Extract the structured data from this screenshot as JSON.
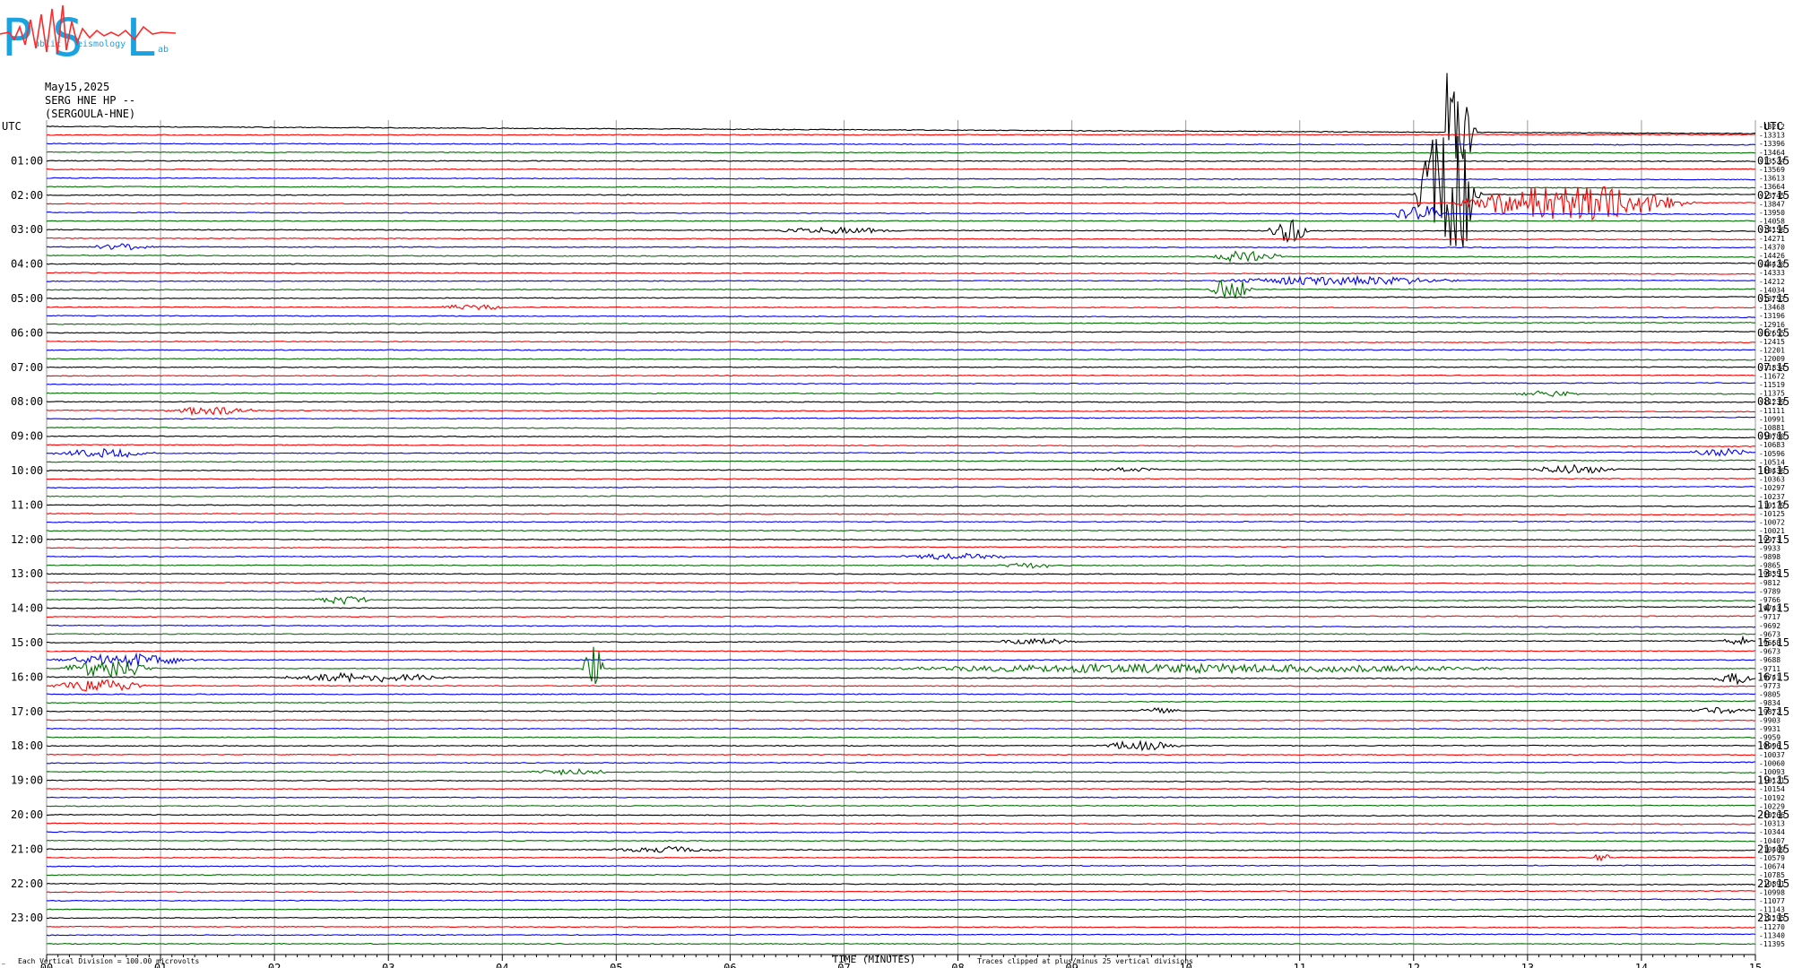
{
  "logo": {
    "letters": [
      "P",
      "S",
      "L"
    ],
    "small_words": [
      "ublic",
      "eismology",
      "ab"
    ],
    "letter_color": "#1aa3e0",
    "seismo_color": "#ff2a2a"
  },
  "header": {
    "date": "May15,2025",
    "station": "SERG HNE HP --",
    "name": "(SERGOULA-HNE)"
  },
  "footer": {
    "left_mark": "—",
    "division_note": "Each Vertical Division =  100.00 microvolts",
    "x_title": "TIME (MINUTES)",
    "clip_note": "Traces clipped at plus/minus 25 vertical divisions"
  },
  "colors": {
    "trace_cycle": [
      "#000000",
      "#ff0000",
      "#0000ff",
      "#007000"
    ],
    "grid": "#9a9a9a",
    "text": "#000000"
  },
  "chart_data": {
    "type": "helicorder",
    "x_axis_unit": "minutes",
    "x_ticks": [
      "00",
      "01",
      "02",
      "03",
      "04",
      "05",
      "06",
      "07",
      "08",
      "09",
      "10",
      "11",
      "12",
      "13",
      "14",
      "15"
    ],
    "xlim": [
      0,
      15
    ],
    "traces_per_hour": 4,
    "minutes_per_trace": 15,
    "trace_count": 96,
    "start_hour": 0,
    "left_axis_title": "UTC",
    "right_axis_title": "UTC",
    "left_hour_labels": [
      "01:00",
      "02:00",
      "03:00",
      "04:00",
      "05:00",
      "06:00",
      "07:00",
      "08:00",
      "09:00",
      "10:00",
      "11:00",
      "12:00",
      "13:00",
      "14:00",
      "15:00",
      "16:00",
      "17:00",
      "18:00",
      "19:00",
      "20:00",
      "21:00",
      "22:00",
      "23:00"
    ],
    "right_hour_labels": [
      "01:15",
      "02:15",
      "03:15",
      "04:15",
      "05:15",
      "06:15",
      "07:15",
      "08:15",
      "09:15",
      "10:15",
      "11:15",
      "12:15",
      "13:15",
      "14:15",
      "15:15",
      "16:15",
      "17:15",
      "18:15",
      "19:15",
      "20:15",
      "21:15",
      "22:15",
      "23:15"
    ],
    "trace_offsets": [
      "-13212",
      "-13313",
      "-13396",
      "-13464",
      "-13524",
      "-13569",
      "-13613",
      "-13664",
      "-13745",
      "-13847",
      "-13950",
      "-14058",
      "-14156",
      "-14271",
      "-14370",
      "-14426",
      "-14420",
      "-14333",
      "-14212",
      "-14034",
      "-13753",
      "-13468",
      "-13196",
      "-12916",
      "-12655",
      "-12415",
      "-12201",
      "-12009",
      "-11834",
      "-11672",
      "-11519",
      "-11375",
      "-11239",
      "-11111",
      "-10991",
      "-10881",
      "-10780",
      "-10683",
      "-10596",
      "-10514",
      "-10436",
      "-10363",
      "-10297",
      "-10237",
      "-10179",
      "-10125",
      "-10072",
      "-10021",
      "-9973",
      "-9933",
      "-9898",
      "-9865",
      "-9835",
      "-9812",
      "-9789",
      "-9766",
      "-9743",
      "-9717",
      "-9692",
      "-9673",
      "-9668",
      "-9673",
      "-9688",
      "-9711",
      "-9741",
      "-9773",
      "-9805",
      "-9834",
      "-9872",
      "-9903",
      "-9931",
      "-9959",
      "-9996",
      "-10037",
      "-10060",
      "-10093",
      "-10121",
      "-10154",
      "-10192",
      "-10229",
      "-10266",
      "-10313",
      "-10344",
      "-10407",
      "-10409",
      "-10579",
      "-10674",
      "-10785",
      "-10891",
      "-10998",
      "-11077",
      "-11143",
      "-11195",
      "-11270",
      "-11340",
      "-11395"
    ],
    "events": [
      {
        "trace": 0,
        "start_min": 12.28,
        "end_min": 12.55,
        "amp_divs": 25,
        "note": "clipped large event"
      },
      {
        "trace": 8,
        "start_min": 12.0,
        "end_min": 12.6,
        "amp_divs": 25
      },
      {
        "trace": 9,
        "start_min": 12.3,
        "end_min": 14.5,
        "amp_divs": 6
      },
      {
        "trace": 10,
        "start_min": 11.8,
        "end_min": 12.3,
        "amp_divs": 3
      },
      {
        "trace": 12,
        "start_min": 6.3,
        "end_min": 7.6,
        "amp_divs": 1
      },
      {
        "trace": 12,
        "start_min": 10.7,
        "end_min": 11.1,
        "amp_divs": 4
      },
      {
        "trace": 14,
        "start_min": 0.3,
        "end_min": 1.0,
        "amp_divs": 1
      },
      {
        "trace": 15,
        "start_min": 10.2,
        "end_min": 10.9,
        "amp_divs": 2
      },
      {
        "trace": 18,
        "start_min": 10.2,
        "end_min": 12.5,
        "amp_divs": 1.5
      },
      {
        "trace": 19,
        "start_min": 10.2,
        "end_min": 10.6,
        "amp_divs": 4
      },
      {
        "trace": 21,
        "start_min": 3.4,
        "end_min": 4.1,
        "amp_divs": 1
      },
      {
        "trace": 31,
        "start_min": 12.8,
        "end_min": 13.5,
        "amp_divs": 1
      },
      {
        "trace": 33,
        "start_min": 1.0,
        "end_min": 1.9,
        "amp_divs": 1.5
      },
      {
        "trace": 38,
        "start_min": 0.0,
        "end_min": 1.0,
        "amp_divs": 1.5
      },
      {
        "trace": 38,
        "start_min": 14.4,
        "end_min": 15.0,
        "amp_divs": 1.5
      },
      {
        "trace": 40,
        "start_min": 9.1,
        "end_min": 9.8,
        "amp_divs": 1
      },
      {
        "trace": 40,
        "start_min": 13.0,
        "end_min": 13.8,
        "amp_divs": 1.5
      },
      {
        "trace": 50,
        "start_min": 7.4,
        "end_min": 8.6,
        "amp_divs": 1
      },
      {
        "trace": 51,
        "start_min": 8.3,
        "end_min": 8.9,
        "amp_divs": 1
      },
      {
        "trace": 55,
        "start_min": 2.3,
        "end_min": 2.9,
        "amp_divs": 1.5
      },
      {
        "trace": 60,
        "start_min": 8.3,
        "end_min": 9.1,
        "amp_divs": 1
      },
      {
        "trace": 60,
        "start_min": 14.7,
        "end_min": 15.0,
        "amp_divs": 1.5
      },
      {
        "trace": 62,
        "start_min": 0.0,
        "end_min": 1.4,
        "amp_divs": 2
      },
      {
        "trace": 63,
        "start_min": 0.1,
        "end_min": 1.0,
        "amp_divs": 3
      },
      {
        "trace": 63,
        "start_min": 4.7,
        "end_min": 4.9,
        "amp_divs": 8
      },
      {
        "trace": 63,
        "start_min": 7.0,
        "end_min": 13.2,
        "amp_divs": 1.5
      },
      {
        "trace": 64,
        "start_min": 2.0,
        "end_min": 3.6,
        "amp_divs": 1.5
      },
      {
        "trace": 64,
        "start_min": 14.6,
        "end_min": 15.0,
        "amp_divs": 2
      },
      {
        "trace": 65,
        "start_min": 0.0,
        "end_min": 0.9,
        "amp_divs": 2
      },
      {
        "trace": 68,
        "start_min": 9.5,
        "end_min": 10.0,
        "amp_divs": 1
      },
      {
        "trace": 68,
        "start_min": 14.4,
        "end_min": 15.0,
        "amp_divs": 1
      },
      {
        "trace": 72,
        "start_min": 9.2,
        "end_min": 10.0,
        "amp_divs": 1.5
      },
      {
        "trace": 75,
        "start_min": 4.2,
        "end_min": 5.0,
        "amp_divs": 1
      },
      {
        "trace": 84,
        "start_min": 4.9,
        "end_min": 6.0,
        "amp_divs": 1
      },
      {
        "trace": 85,
        "start_min": 13.5,
        "end_min": 13.8,
        "amp_divs": 1
      }
    ]
  }
}
